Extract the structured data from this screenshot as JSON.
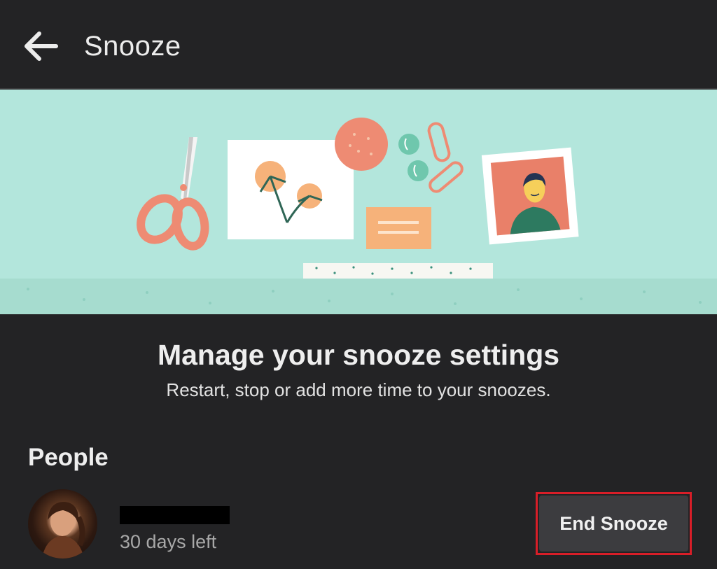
{
  "appbar": {
    "title": "Snooze",
    "back_icon": "arrow-left-icon"
  },
  "banner": {
    "illustration_icons": [
      "scissors-icon",
      "flower-card-icon",
      "sun-circle-icon",
      "pushpin-icon",
      "paperclip-icon",
      "note-card-icon",
      "washi-tape-icon",
      "portrait-photo-icon"
    ],
    "background_color": "#b3e6dc"
  },
  "main": {
    "heading": "Manage your snooze settings",
    "subheading": "Restart, stop or add more time to your snoozes."
  },
  "people": {
    "section_title": "People",
    "items": [
      {
        "name": "",
        "time_left": "30 days left",
        "action_label": "End Snooze"
      }
    ]
  },
  "colors": {
    "background": "#232325",
    "button": "#3c3c3f",
    "highlight": "#d81e28"
  }
}
